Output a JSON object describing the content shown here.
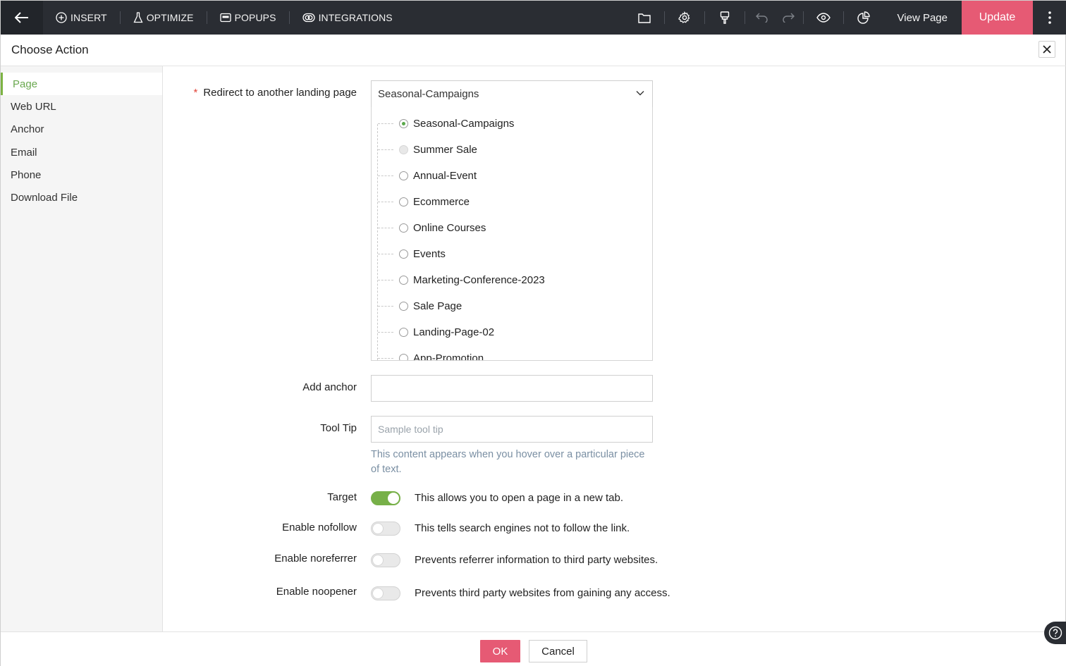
{
  "topbar": {
    "menu": [
      {
        "label": "INSERT",
        "icon": "plus-circle-icon"
      },
      {
        "label": "OPTIMIZE",
        "icon": "flask-icon"
      },
      {
        "label": "POPUPS",
        "icon": "popup-icon"
      },
      {
        "label": "INTEGRATIONS",
        "icon": "integrations-icon"
      }
    ],
    "view_page": "View Page",
    "update": "Update"
  },
  "dialog": {
    "title": "Choose Action"
  },
  "sidebar": {
    "items": [
      {
        "label": "Page",
        "active": true
      },
      {
        "label": "Web URL"
      },
      {
        "label": "Anchor"
      },
      {
        "label": "Email"
      },
      {
        "label": "Phone"
      },
      {
        "label": "Download File"
      }
    ]
  },
  "form": {
    "redirect_label": "Redirect to another landing page",
    "selected_page": "Seasonal-Campaigns",
    "page_options": [
      {
        "label": "Seasonal-Campaigns",
        "state": "checked"
      },
      {
        "label": "Summer Sale",
        "state": "disabled"
      },
      {
        "label": "Annual-Event",
        "state": "unchecked"
      },
      {
        "label": "Ecommerce",
        "state": "unchecked"
      },
      {
        "label": "Online Courses",
        "state": "unchecked"
      },
      {
        "label": "Events",
        "state": "unchecked"
      },
      {
        "label": "Marketing-Conference-2023",
        "state": "unchecked"
      },
      {
        "label": "Sale Page",
        "state": "unchecked"
      },
      {
        "label": "Landing-Page-02",
        "state": "unchecked"
      },
      {
        "label": "App-Promotion",
        "state": "unchecked"
      }
    ],
    "anchor_label": "Add anchor",
    "anchor_value": "",
    "tooltip_label": "Tool Tip",
    "tooltip_placeholder": "Sample tool tip",
    "tooltip_hint": "This content appears when you hover over a particular piece of text.",
    "toggles": [
      {
        "label": "Target",
        "on": true,
        "desc": "This allows you to open a page in a new tab."
      },
      {
        "label": "Enable nofollow",
        "on": false,
        "desc": "This tells search engines not to follow the link."
      },
      {
        "label": "Enable noreferrer",
        "on": false,
        "desc": "Prevents referrer information to third party websites."
      },
      {
        "label": "Enable noopener",
        "on": false,
        "desc": "Prevents third party websites from gaining any access."
      }
    ]
  },
  "footer": {
    "ok": "OK",
    "cancel": "Cancel"
  },
  "colors": {
    "accent": "#e65a74",
    "toggle_on": "#77b048",
    "active_nav": "#6aa84f",
    "topbar_bg": "#2a2d33"
  }
}
